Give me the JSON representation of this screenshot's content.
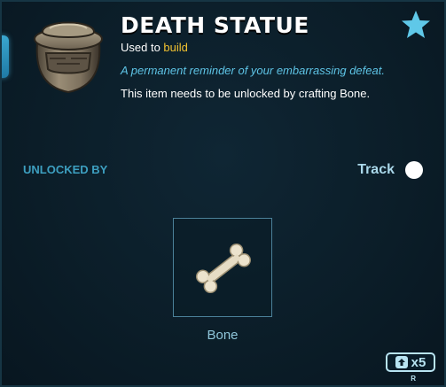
{
  "item": {
    "title": "DEATH STATUE",
    "used_to_prefix": "Used to ",
    "used_to_keyword": "build",
    "flavor_text": "A permanent reminder of your embarrassing defeat.",
    "requirement_text": "This item needs to be unlocked by crafting Bone.",
    "icon": "death-statue-icon"
  },
  "favorite": {
    "icon": "star-icon",
    "color": "#5fc8e8"
  },
  "unlock": {
    "section_label": "UNLOCKED BY",
    "track_label": "Track",
    "slots": [
      {
        "label": "Bone",
        "icon": "bone-icon"
      }
    ]
  },
  "craft": {
    "icon": "arrow-up-icon",
    "count_label": "x5",
    "key_hint": "R"
  },
  "colors": {
    "accent": "#3d9fc0",
    "keyword": "#f2c230",
    "flavor": "#5ec4e6"
  }
}
